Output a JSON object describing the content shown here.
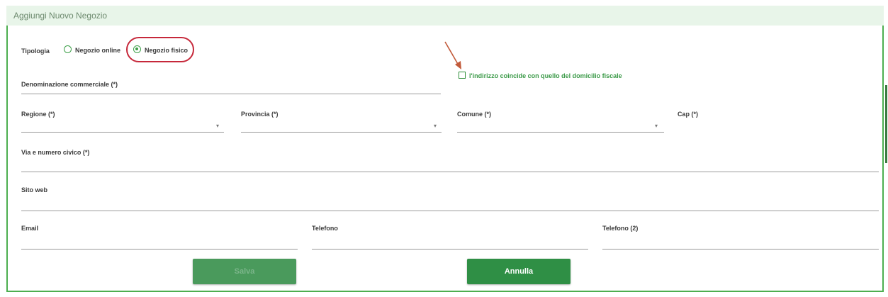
{
  "header": {
    "title": "Aggiungi Nuovo Negozio"
  },
  "tipologia": {
    "label": "Tipologia",
    "options": [
      {
        "label": "Negozio online",
        "selected": false
      },
      {
        "label": "Negozio fisico",
        "selected": true
      }
    ]
  },
  "fields": {
    "denominazione": "Denominazione commerciale (*)",
    "regione": "Regione (*)",
    "provincia": "Provincia (*)",
    "comune": "Comune (*)",
    "cap": "Cap (*)",
    "via": "Via e numero civico (*)",
    "sito": "Sito web",
    "email": "Email",
    "telefono": "Telefono",
    "telefono2": "Telefono (2)"
  },
  "checkbox": {
    "label": "l'indirizzo coincide con quello del domicilio fiscale",
    "checked": false
  },
  "buttons": {
    "save": "Salva",
    "cancel": "Annulla"
  },
  "colors": {
    "accent": "#2f8f45",
    "border": "#4cae4f",
    "header_bg": "#e8f5e9",
    "annotation": "#c6283a"
  }
}
